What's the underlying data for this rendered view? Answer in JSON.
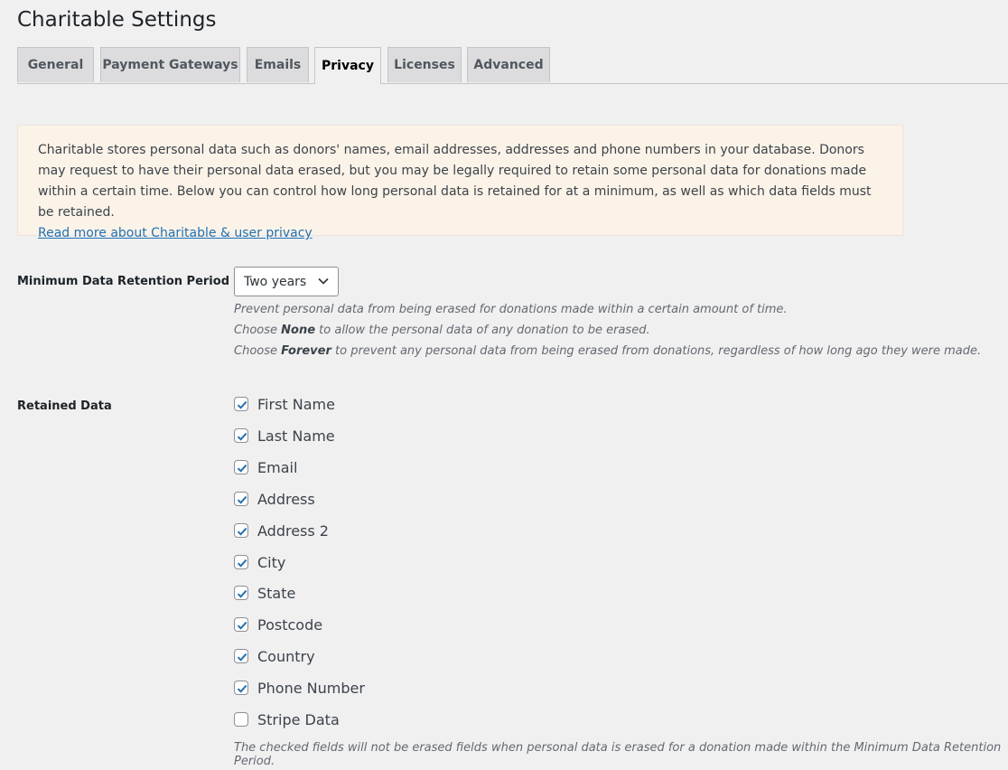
{
  "page": {
    "title": "Charitable Settings"
  },
  "tabs": [
    {
      "label": "General",
      "active": false
    },
    {
      "label": "Payment Gateways",
      "active": false
    },
    {
      "label": "Emails",
      "active": false
    },
    {
      "label": "Privacy",
      "active": true
    },
    {
      "label": "Licenses",
      "active": false
    },
    {
      "label": "Advanced",
      "active": false
    }
  ],
  "notice": {
    "text": "Charitable stores personal data such as donors' names, email addresses, addresses and phone numbers in your database. Donors may request to have their personal data erased, but you may be legally required to retain some personal data for donations made within a certain time. Below you can control how long personal data is retained for at a minimum, as well as which data fields must be retained.",
    "link": "Read more about Charitable & user privacy"
  },
  "retention": {
    "label": "Minimum Data Retention Period",
    "selected": "Two years",
    "desc_line1": "Prevent personal data from being erased for donations made within a certain amount of time.",
    "desc_line2_pre": "Choose ",
    "desc_line2_bold": "None",
    "desc_line2_post": " to allow the personal data of any donation to be erased.",
    "desc_line3_pre": "Choose ",
    "desc_line3_bold": "Forever",
    "desc_line3_post": " to prevent any personal data from being erased from donations, regardless of how long ago they were made."
  },
  "retained": {
    "label": "Retained Data",
    "fields": [
      {
        "label": "First Name",
        "checked": true
      },
      {
        "label": "Last Name",
        "checked": true
      },
      {
        "label": "Email",
        "checked": true
      },
      {
        "label": "Address",
        "checked": true
      },
      {
        "label": "Address 2",
        "checked": true
      },
      {
        "label": "City",
        "checked": true
      },
      {
        "label": "State",
        "checked": true
      },
      {
        "label": "Postcode",
        "checked": true
      },
      {
        "label": "Country",
        "checked": true
      },
      {
        "label": "Phone Number",
        "checked": true
      },
      {
        "label": "Stripe Data",
        "checked": false
      }
    ],
    "note": "The checked fields will not be erased fields when personal data is erased for a donation made within the Minimum Data Retention Period."
  },
  "colors": {
    "accent": "#2271b1",
    "notice_bg": "#fcf3e8",
    "page_bg": "#f0f0f1"
  },
  "icons": {
    "select_arrow": "chevron-down-icon",
    "checkbox_mark": "checkmark-icon"
  }
}
